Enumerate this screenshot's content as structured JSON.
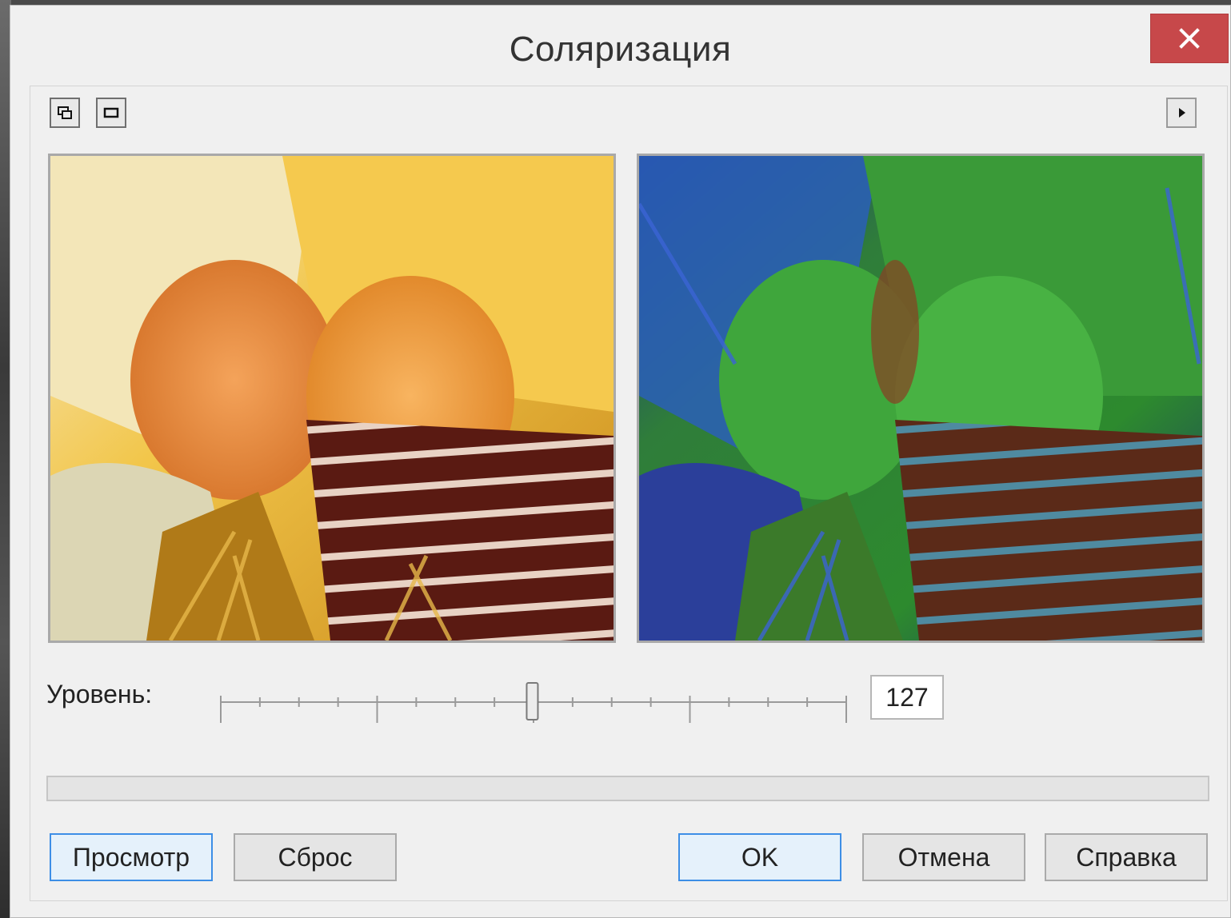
{
  "window": {
    "title": "Соляризация",
    "close_icon": "close-icon"
  },
  "toolbar": {
    "left_icons": [
      "split-view-icon",
      "single-view-icon"
    ],
    "right_icon": "play-arrow-icon"
  },
  "previews": {
    "original_desc": "original-photo",
    "result_desc": "solarized-photo"
  },
  "level": {
    "label": "Уровень:",
    "value": "127",
    "min": 0,
    "max": 255
  },
  "progress": {
    "fraction": 0
  },
  "buttons": {
    "preview": "Просмотр",
    "reset": "Сброс",
    "ok": "OK",
    "cancel": "Отмена",
    "help": "Справка"
  },
  "colors": {
    "close_button": "#c7484a",
    "primary_border": "#3d8ee6",
    "primary_bg": "#e5f1fb"
  }
}
